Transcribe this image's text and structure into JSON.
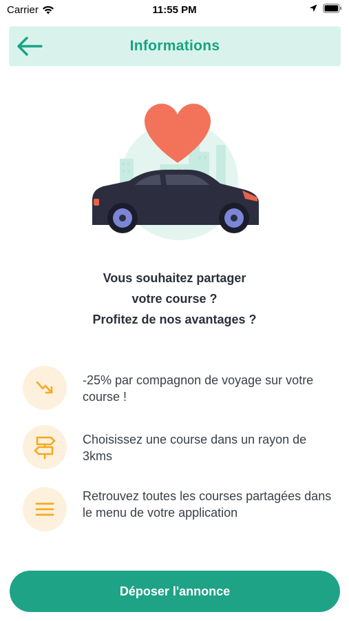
{
  "status_bar": {
    "carrier": "Carrier",
    "time": "11:55 PM"
  },
  "header": {
    "title": "Informations",
    "back_icon": "arrow-left-icon"
  },
  "illustration": {
    "description_icons": [
      "heart-icon",
      "car-icon",
      "city-icon"
    ]
  },
  "intro": {
    "line1": "Vous souhaitez partager",
    "line2": "votre course ?",
    "line3": "Profitez de nos avantages ?"
  },
  "benefits": [
    {
      "icon": "trend-down-icon",
      "text": "-25% par compagnon de voyage sur votre course !"
    },
    {
      "icon": "signpost-icon",
      "text": "Choisissez une course dans un rayon de 3kms"
    },
    {
      "icon": "menu-icon",
      "text": "Retrouvez toutes les courses partagées dans le menu de votre application"
    }
  ],
  "cta": {
    "label": "Déposer l'annonce"
  },
  "colors": {
    "accent": "#1ea386",
    "header_bg": "#d9f3ec",
    "icon_circle": "#fdf1de",
    "icon_color": "#f6a91e",
    "heart": "#f2735a",
    "car": "#2c2d3f"
  }
}
